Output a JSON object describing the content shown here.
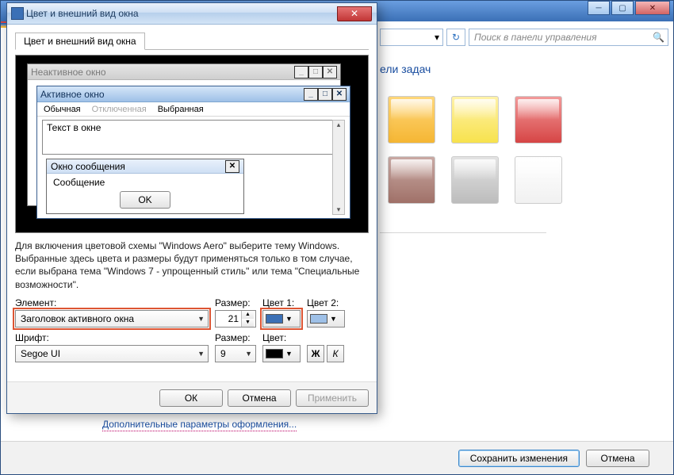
{
  "parent": {
    "search_placeholder": "Поиск в панели управления",
    "heading_fragment": "ели задач",
    "more_link": "Дополнительные параметры оформления...",
    "save_button": "Сохранить изменения",
    "cancel_button": "Отмена",
    "swatch_colors": [
      "#f5b633",
      "#f7e24d",
      "#d64545",
      "#a07168",
      "#bcbcbc",
      "#f1f1f1"
    ]
  },
  "dialog": {
    "title": "Цвет и внешний вид окна",
    "tab_label": "Цвет и внешний вид окна",
    "preview": {
      "inactive_title": "Неактивное окно",
      "active_title": "Активное окно",
      "menu_normal": "Обычная",
      "menu_disabled": "Отключенная",
      "menu_selected": "Выбранная",
      "window_text": "Текст в окне",
      "msg_title": "Окно сообщения",
      "msg_body": "Сообщение",
      "msg_ok": "OK"
    },
    "description": "Для включения цветовой схемы \"Windows Aero\" выберите тему Windows. Выбранные здесь цвета и размеры будут применяться только в том случае, если выбрана тема \"Windows 7 - упрощенный стиль\" или тема \"Специальные возможности\".",
    "labels": {
      "element": "Элемент:",
      "size": "Размер:",
      "color1": "Цвет 1:",
      "color2": "Цвет 2:",
      "font": "Шрифт:",
      "font_size": "Размер:",
      "font_color": "Цвет:"
    },
    "values": {
      "element_selected": "Заголовок активного окна",
      "size": "21",
      "color1": "#3b70b6",
      "color2": "#9ec0e7",
      "font_selected": "Segoe UI",
      "font_size": "9",
      "font_color": "#000000",
      "bold_label": "Ж",
      "italic_label": "К"
    },
    "buttons": {
      "ok": "ОК",
      "cancel": "Отмена",
      "apply": "Применить"
    }
  }
}
